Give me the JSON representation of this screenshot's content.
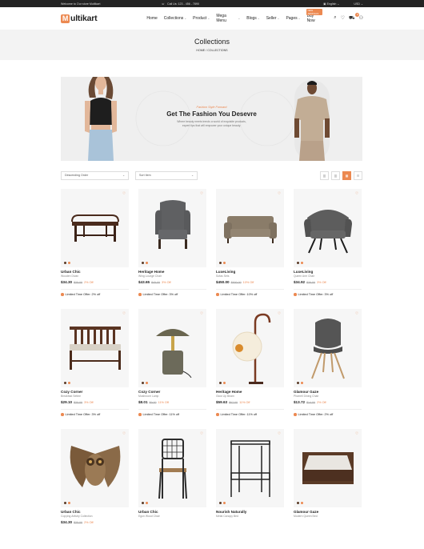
{
  "topbar": {
    "welcome": "Welcome to Our store Multikart",
    "call_label": "Call Us: 123 - 456 - 7890",
    "language": "English",
    "currency": "USD"
  },
  "header": {
    "logo_letter": "M",
    "logo_text": "ultikart",
    "nav": [
      "Home",
      "Collections",
      "Product",
      "Mega Menu",
      "Blogs",
      "Seller",
      "Pages",
      "Buy Now"
    ],
    "new_badge": "NEW ARRIVALS",
    "cart_count": "0"
  },
  "page": {
    "title": "Collections",
    "breadcrumb": "HOME / COLLECTIONS"
  },
  "banner": {
    "kicker": "Fashion Style Forward",
    "title": "Get The Fashion You Desevre",
    "sub1": "Where beauty meets trends a world of exquisite products,",
    "sub2": "expert tips that will empower your unique beauty."
  },
  "filters": {
    "sort": "Descending Order",
    "sort_arrow": "⌄",
    "sort_item": "Sort Item",
    "sort_item_arrow": "⌄"
  },
  "accent": "#ec8951",
  "products": [
    {
      "name": "Urban Chic",
      "cat": "Wooden Divan",
      "price": "$34.30",
      "old": "$35.00",
      "off": "2% Off",
      "offer": "Limited Time Offer: 2% off",
      "art": "bench"
    },
    {
      "name": "Heritage Home",
      "cat": "Wing Lounge Chair",
      "price": "$43.65",
      "old": "$45.00",
      "off": "3% Off",
      "offer": "Limited Time Offer: 3% off",
      "art": "wingchair"
    },
    {
      "name": "LuxeLiving",
      "cat": "Sofas Sets",
      "price": "$450.00",
      "old": "$500.00",
      "off": "10% Off",
      "offer": "Limited Time Offer: 10% off",
      "art": "sofa"
    },
    {
      "name": "LuxeLiving",
      "cat": "Queen Arm Chair",
      "price": "$34.92",
      "old": "$36.00",
      "off": "3% Off",
      "offer": "Limited Time Offer: 3% off",
      "art": "armchair"
    },
    {
      "name": "Cozy Corner",
      "cat": "Breakfast Settee",
      "price": "$29.10",
      "old": "$30.00",
      "off": "3% Off",
      "offer": "Limited Time Offer: 3% off",
      "art": "settee"
    },
    {
      "name": "Cozy Corner",
      "cat": "Mushroom Lamp",
      "price": "$8.01",
      "old": "$9.00",
      "off": "11% Off",
      "offer": "Limited Time Offer: 11% off",
      "art": "lamp"
    },
    {
      "name": "Heritage Home",
      "cat": "Glow Up Beam",
      "price": "$59.63",
      "old": "$67.00",
      "off": "11% Off",
      "offer": "Limited Time Offer: 11% off",
      "art": "floorlamp"
    },
    {
      "name": "Glamour Gaze",
      "cat": "Pharrell Dining Chair",
      "price": "$13.72",
      "old": "$14.00",
      "off": "2% Off",
      "offer": "Limited Time Offer: 2% off",
      "art": "tulipchair"
    },
    {
      "name": "Urban Chic",
      "cat": "Copying Artistry Collection",
      "price": "$34.30",
      "old": "$35.00",
      "off": "2% Off",
      "offer": "",
      "art": "owl"
    },
    {
      "name": "Urban Chic",
      "cat": "Egon Wood Chair",
      "price": "",
      "old": "",
      "off": "",
      "offer": "",
      "art": "woodchair"
    },
    {
      "name": "Nourish Naturally",
      "cat": "Metal Canopy Bed",
      "price": "",
      "old": "",
      "off": "",
      "offer": "",
      "art": "canopy"
    },
    {
      "name": "Glamour Gaze",
      "cat": "Modern Queen Bed",
      "price": "",
      "old": "",
      "off": "",
      "offer": "",
      "art": "bed"
    }
  ]
}
